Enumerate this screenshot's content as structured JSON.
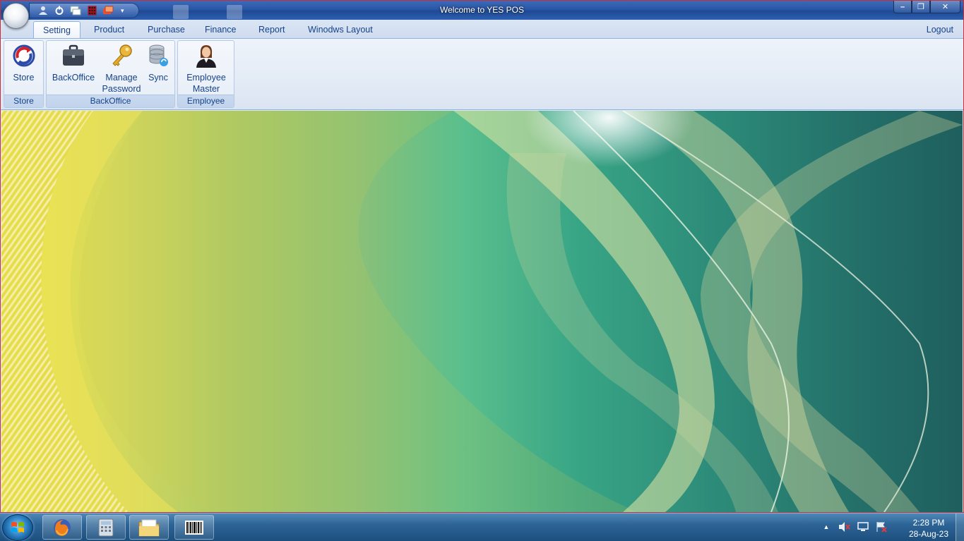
{
  "window": {
    "title": "Welcome to YES POS",
    "minimize_label": "–",
    "restore_label": "❐",
    "close_label": "✕"
  },
  "quick_access": {
    "icons": [
      "user-icon",
      "refresh-icon",
      "windows-icon",
      "calculator-icon",
      "card-icon"
    ],
    "dropdown": "▾"
  },
  "tabs": [
    {
      "label": "Setting",
      "active": true
    },
    {
      "label": "Product"
    },
    {
      "label": "Purchase"
    },
    {
      "label": "Finance"
    },
    {
      "label": "Report"
    },
    {
      "label": "Winodws Layout"
    }
  ],
  "logout_label": "Logout",
  "ribbon": {
    "groups": [
      {
        "label": "Store",
        "buttons": [
          {
            "label_line1": "Store",
            "label_line2": "",
            "icon": "store-sync-icon"
          }
        ]
      },
      {
        "label": "BackOffice",
        "buttons": [
          {
            "label_line1": "BackOffice",
            "label_line2": "",
            "icon": "briefcase-icon"
          },
          {
            "label_line1": "Manage",
            "label_line2": "Password",
            "icon": "key-icon"
          },
          {
            "label_line1": "Sync",
            "label_line2": "",
            "icon": "database-sync-icon"
          }
        ]
      },
      {
        "label": "Employee",
        "buttons": [
          {
            "label_line1": "Employee",
            "label_line2": "Master",
            "icon": "employee-icon"
          }
        ]
      }
    ]
  },
  "taskbar": {
    "pinned": [
      "firefox-icon",
      "calculator-icon",
      "file-explorer-icon",
      "barcode-icon"
    ],
    "tray_icons": [
      "show-hidden-icons-arrow",
      "volume-muted-icon",
      "network-icon",
      "action-center-icon"
    ],
    "tray_arrow": "▲",
    "time": "2:28 PM",
    "date": "28-Aug-23"
  },
  "colors": {
    "titlebar": "#2a56a6",
    "window_border": "#c7303b",
    "ribbon_text": "#15428b"
  }
}
